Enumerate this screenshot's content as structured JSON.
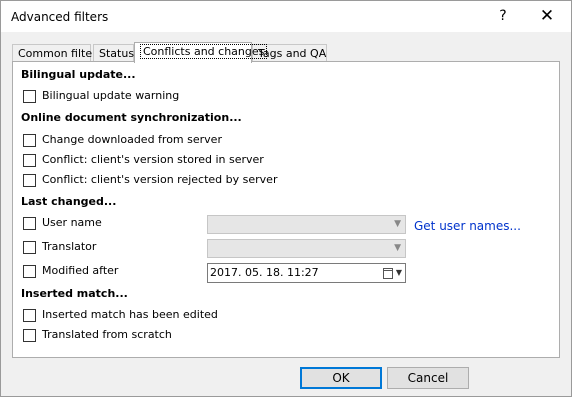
{
  "window": {
    "title": "Advanced filters",
    "help_label": "?",
    "close_label": "✕"
  },
  "tabs": [
    {
      "label": "Common filters",
      "active": false
    },
    {
      "label": "Status",
      "active": false
    },
    {
      "label": "Conflicts and changes",
      "active": true
    },
    {
      "label": "Tags and QA",
      "active": false
    }
  ],
  "sections": {
    "bilingual": "Bilingual update...",
    "online": "Online document synchronization...",
    "last_changed": "Last changed...",
    "inserted": "Inserted match..."
  },
  "checkboxes": {
    "bilingual_warning": "Bilingual update warning",
    "change_downloaded": "Change downloaded from server",
    "conflict_stored": "Conflict: client's version stored in server",
    "conflict_rejected": "Conflict: client's version rejected by server",
    "user_name": "User name",
    "translator": "Translator",
    "modified_after": "Modified after",
    "inserted_edited": "Inserted match has been edited",
    "translated_scratch": "Translated from scratch"
  },
  "fields": {
    "user_name_value": "",
    "translator_value": "",
    "modified_after_value": "2017. 05. 18. 11:27"
  },
  "links": {
    "get_user_names": "Get user names..."
  },
  "buttons": {
    "ok": "OK",
    "cancel": "Cancel"
  },
  "icons": {
    "dropdown": "chevron-down-icon",
    "calendar": "calendar-icon"
  }
}
